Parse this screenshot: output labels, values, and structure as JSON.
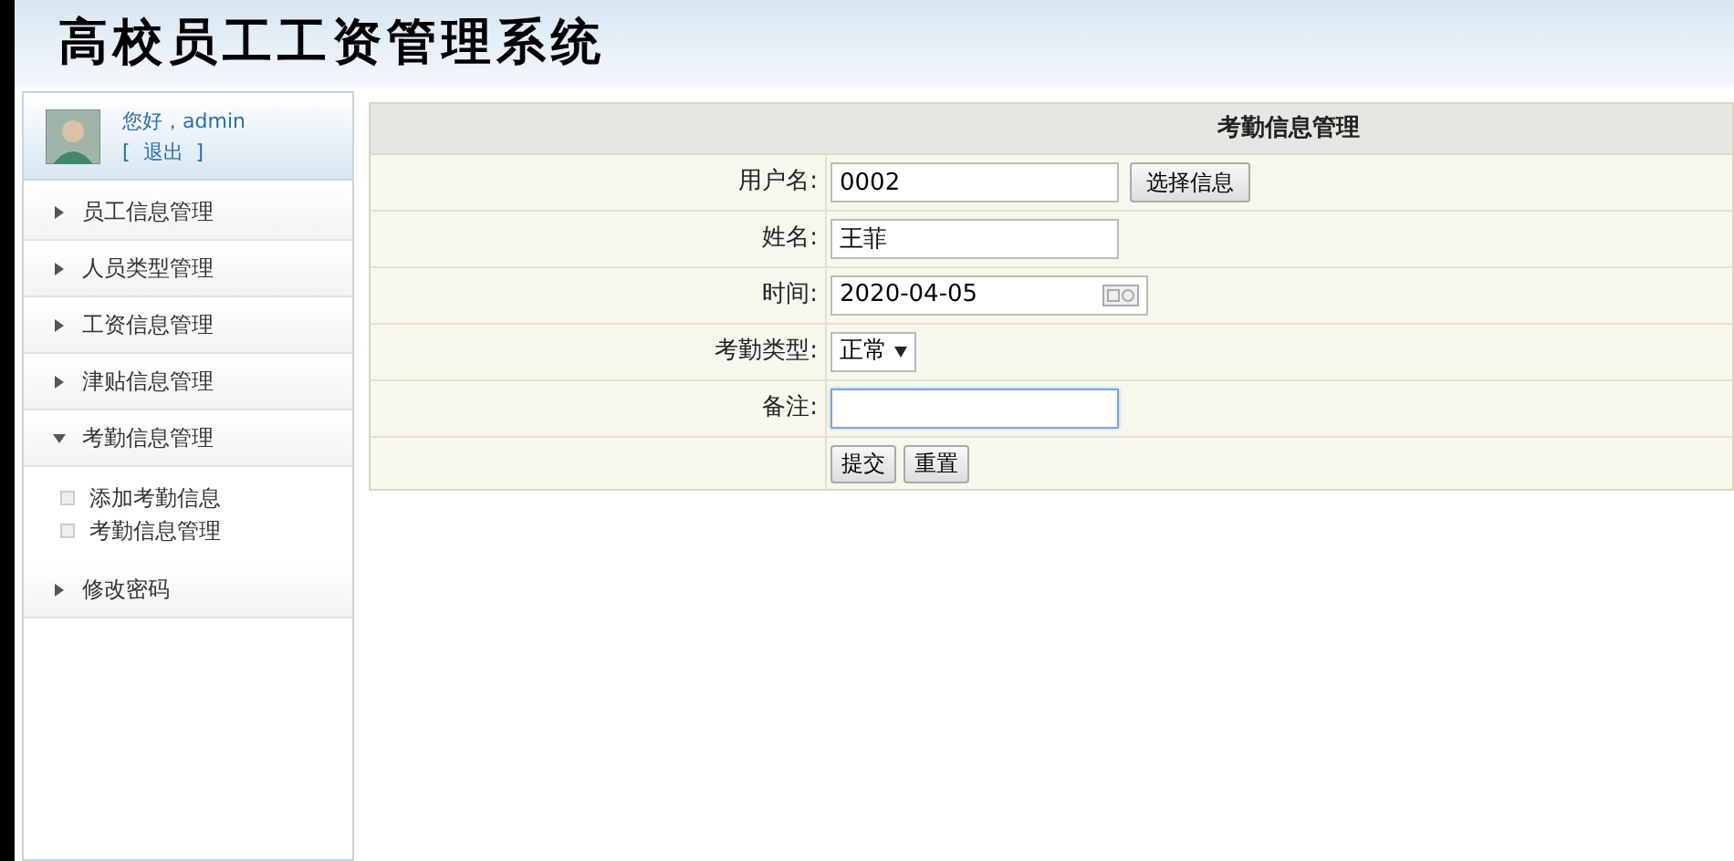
{
  "header": {
    "title": "高校员工工资管理系统"
  },
  "user": {
    "greeting": "您好，admin",
    "logout": "[  退出  ]"
  },
  "menu": [
    {
      "label": "员工信息管理",
      "expanded": false
    },
    {
      "label": "人员类型管理",
      "expanded": false
    },
    {
      "label": "工资信息管理",
      "expanded": false
    },
    {
      "label": "津贴信息管理",
      "expanded": false
    },
    {
      "label": "考勤信息管理",
      "expanded": true,
      "children": [
        {
          "label": "添加考勤信息"
        },
        {
          "label": "考勤信息管理"
        }
      ]
    },
    {
      "label": "修改密码",
      "expanded": false
    }
  ],
  "form": {
    "title": "考勤信息管理",
    "rows": [
      {
        "kind": "text",
        "label": "用户名:",
        "value": "0002",
        "button": "选择信息"
      },
      {
        "kind": "text",
        "label": "姓名:",
        "value": "王菲"
      },
      {
        "kind": "date",
        "label": "时间:",
        "value": "2020-04-05"
      },
      {
        "kind": "select",
        "label": "考勤类型:",
        "value": "正常"
      },
      {
        "kind": "text",
        "label": "备注:",
        "value": "",
        "focused": true
      }
    ],
    "buttons": [
      "提交",
      "重置"
    ]
  }
}
